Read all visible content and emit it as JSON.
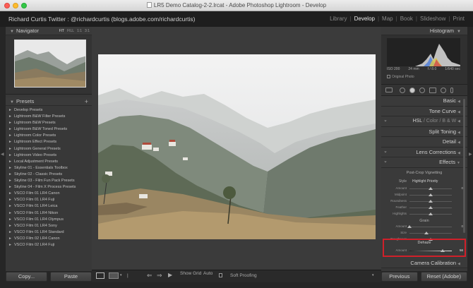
{
  "window": {
    "title": "LR5 Demo Catalog-2-2.lrcat - Adobe Photoshop Lightroom - Develop"
  },
  "identity_plate": "Richard Curtis Twitter : @richardcurtis (blogs.adobe.com/richardcurtis)",
  "modules": [
    {
      "label": "Library",
      "active": false
    },
    {
      "label": "Develop",
      "active": true
    },
    {
      "label": "Map",
      "active": false
    },
    {
      "label": "Book",
      "active": false
    },
    {
      "label": "Slideshow",
      "active": false
    },
    {
      "label": "Print",
      "active": false
    }
  ],
  "navigator": {
    "title": "Navigator",
    "modes": [
      "FIT",
      "FILL",
      "1:1",
      "3:1"
    ]
  },
  "presets": {
    "title": "Presets",
    "items": [
      {
        "label": "Develop Presets",
        "arrow": "►"
      },
      {
        "label": "Lightroom B&W Filter Presets",
        "arrow": "►"
      },
      {
        "label": "Lightroom B&W Presets",
        "arrow": "►"
      },
      {
        "label": "Lightroom B&W Toned Presets",
        "arrow": "►"
      },
      {
        "label": "Lightroom Color Presets",
        "arrow": "►"
      },
      {
        "label": "Lightroom Effect Presets",
        "arrow": "►"
      },
      {
        "label": "Lightroom General Presets",
        "arrow": "►"
      },
      {
        "label": "Lightroom Video Presets",
        "arrow": "►"
      },
      {
        "label": "Local Adjustment Presets",
        "arrow": "►"
      },
      {
        "label": "Skyline 01 - Essentials Toolbox",
        "arrow": "►"
      },
      {
        "label": "Skyline 02 - Classic Presets",
        "arrow": "►"
      },
      {
        "label": "Skyline 03 - Film Fun Pack Presets",
        "arrow": "►"
      },
      {
        "label": "Skyline 04 - Film X Process Presets",
        "arrow": "►"
      },
      {
        "label": "VSCO Film 01 LR4 Canon",
        "arrow": "►"
      },
      {
        "label": "VSCO Film 01 LR4 Fuji",
        "arrow": "►"
      },
      {
        "label": "VSCO Film 01 LR4 Leica",
        "arrow": "►"
      },
      {
        "label": "VSCO Film 01 LR4 Nikon",
        "arrow": "►"
      },
      {
        "label": "VSCO Film 01 LR4 Olympus",
        "arrow": "►"
      },
      {
        "label": "VSCO Film 01 LR4 Sony",
        "arrow": "►"
      },
      {
        "label": "VSCO Film 01 LR4 Standard",
        "arrow": "►"
      },
      {
        "label": "VSCO Film 02 LR4 Canon",
        "arrow": "►"
      },
      {
        "label": "VSCO Film 02 LR4 Fuji",
        "arrow": "►"
      }
    ]
  },
  "left_buttons": {
    "copy": "Copy...",
    "paste": "Paste"
  },
  "toolbar": {
    "show_grid": "Show Grid",
    "auto": "Auto",
    "soft_proofing": "Soft Proofing"
  },
  "histogram": {
    "title": "Histogram",
    "iso": "ISO 200",
    "focal": "24 mm",
    "aperture": "f / 8.0",
    "shutter": "1/640 sec",
    "original_photo": "Original Photo"
  },
  "sections": {
    "basic": "Basic",
    "tone_curve": "Tone Curve",
    "hsl": "HSL",
    "color": "Color",
    "bw": "B & W",
    "split_toning": "Split Toning",
    "detail": "Detail",
    "lens_corrections": "Lens Corrections",
    "effects": "Effects",
    "camera_calibration": "Camera Calibration"
  },
  "effects": {
    "vignetting_title": "Post-Crop Vignetting",
    "style_label": "Style",
    "style_value": "Highlight Priority",
    "vignette_rows": [
      {
        "label": "Amount",
        "value": "0",
        "pos": 0.5
      },
      {
        "label": "Midpoint",
        "value": "",
        "pos": 0.5
      },
      {
        "label": "Roundness",
        "value": "",
        "pos": 0.5
      },
      {
        "label": "Feather",
        "value": "",
        "pos": 0.5
      },
      {
        "label": "Highlights",
        "value": "",
        "pos": 0.5
      }
    ],
    "grain_title": "Grain",
    "grain_rows": [
      {
        "label": "Amount",
        "value": "0",
        "pos": 0.0
      },
      {
        "label": "Size",
        "value": "",
        "pos": 0.4
      },
      {
        "label": "Roughness",
        "value": "",
        "pos": 0.5
      }
    ],
    "dehaze_title": "Dehaze",
    "dehaze_row": {
      "label": "Amount",
      "value": "56",
      "pos": 0.78
    }
  },
  "right_buttons": {
    "previous": "Previous",
    "reset": "Reset (Adobe)"
  },
  "colors": {
    "highlight_box": "#d0202a",
    "panel": "#383838"
  }
}
